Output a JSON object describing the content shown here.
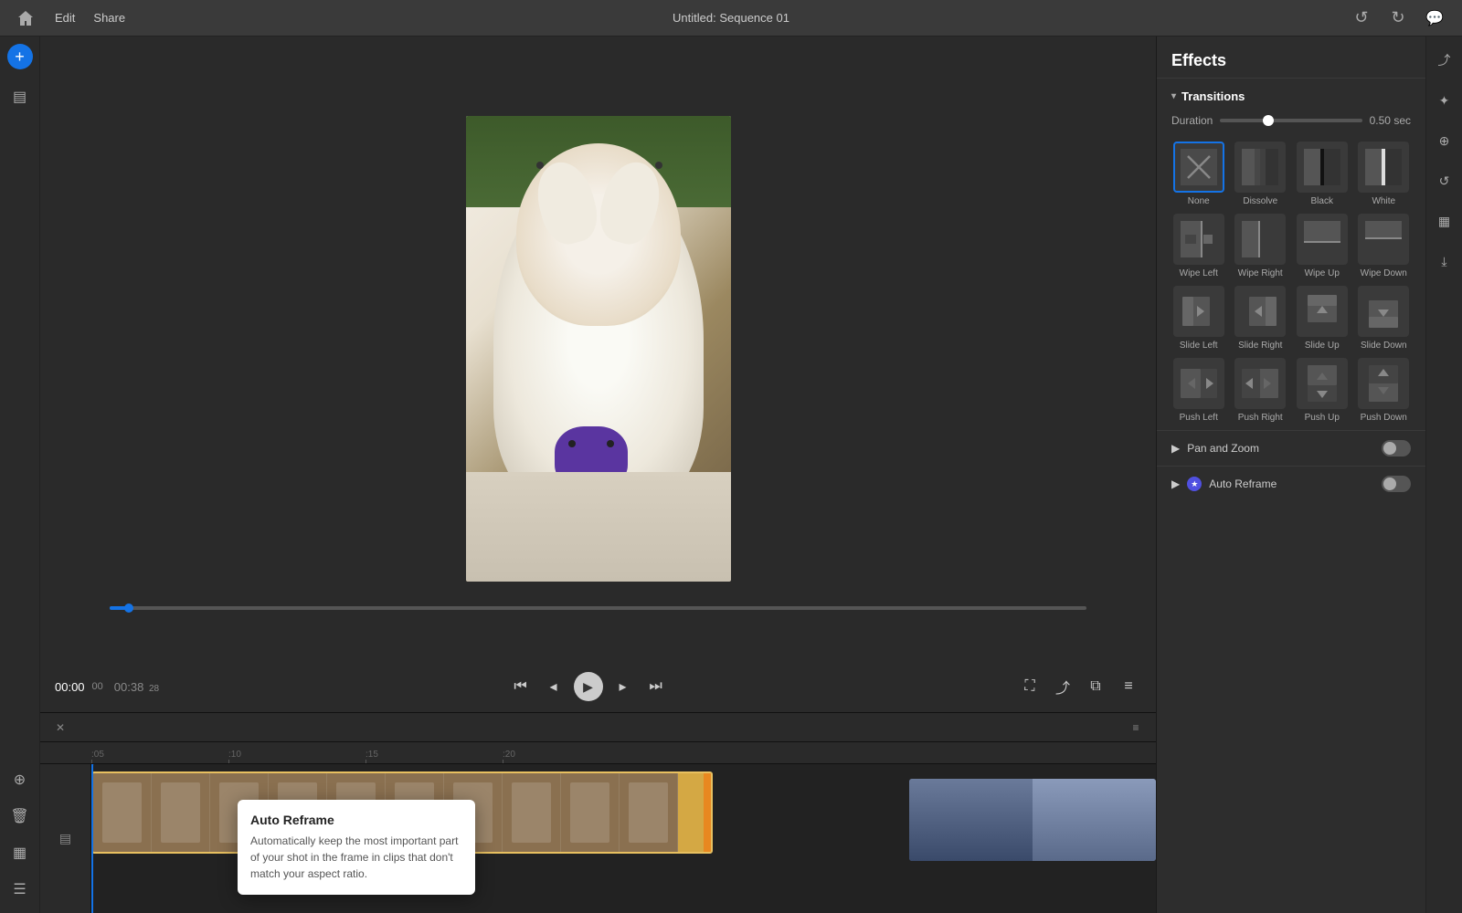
{
  "app": {
    "title": "Untitled: Sequence 01",
    "menu": {
      "edit": "Edit",
      "share": "Share"
    }
  },
  "topbar": {
    "undo_tooltip": "Undo",
    "redo_tooltip": "Redo",
    "chat_tooltip": "Chat"
  },
  "effects": {
    "panel_title": "Effects",
    "transitions": {
      "section_label": "Transitions",
      "duration_label": "Duration",
      "duration_value": "0.50 sec",
      "items": [
        {
          "id": "none",
          "label": "None",
          "selected": true
        },
        {
          "id": "dissolve",
          "label": "Dissolve",
          "selected": false
        },
        {
          "id": "black",
          "label": "Black",
          "selected": false
        },
        {
          "id": "white",
          "label": "White",
          "selected": false
        },
        {
          "id": "wipe-left",
          "label": "Wipe Left",
          "selected": false
        },
        {
          "id": "wipe-right",
          "label": "Wipe Right",
          "selected": false
        },
        {
          "id": "wipe-up",
          "label": "Wipe Up",
          "selected": false
        },
        {
          "id": "wipe-down",
          "label": "Wipe Down",
          "selected": false
        },
        {
          "id": "slide-left",
          "label": "Slide Left",
          "selected": false
        },
        {
          "id": "slide-right",
          "label": "Slide Right",
          "selected": false
        },
        {
          "id": "slide-up",
          "label": "Slide Up",
          "selected": false
        },
        {
          "id": "slide-down",
          "label": "Slide Down",
          "selected": false
        },
        {
          "id": "push-left",
          "label": "Push Left",
          "selected": false
        },
        {
          "id": "push-right",
          "label": "Push Right",
          "selected": false
        },
        {
          "id": "push-up",
          "label": "Push Up",
          "selected": false
        },
        {
          "id": "push-down",
          "label": "Push Down",
          "selected": false
        }
      ]
    },
    "pan_zoom": {
      "label": "Pan and Zoom",
      "enabled": false
    },
    "auto_reframe": {
      "label": "Auto Reframe",
      "enabled": false,
      "badge": "★"
    }
  },
  "playback": {
    "current_time": "00:00",
    "current_frames": "00",
    "total_time": "00:38",
    "total_frames": "28"
  },
  "timeline": {
    "ruler_marks": [
      ":05",
      ":10",
      ":15",
      ":20"
    ]
  },
  "tooltip": {
    "title": "Auto Reframe",
    "description": "Automatically keep the most important part of your shot in the frame in clips that don't match your aspect ratio."
  },
  "sidebar": {
    "items": [
      {
        "id": "home",
        "icon": "⌂",
        "label": "Home"
      },
      {
        "id": "library",
        "icon": "▤",
        "label": "Library"
      },
      {
        "id": "layers",
        "icon": "⊕",
        "label": "Layers"
      },
      {
        "id": "trash",
        "icon": "🗑",
        "label": "Trash"
      },
      {
        "id": "grid",
        "icon": "▦",
        "label": "Grid"
      },
      {
        "id": "list",
        "icon": "☰",
        "label": "List"
      }
    ]
  }
}
